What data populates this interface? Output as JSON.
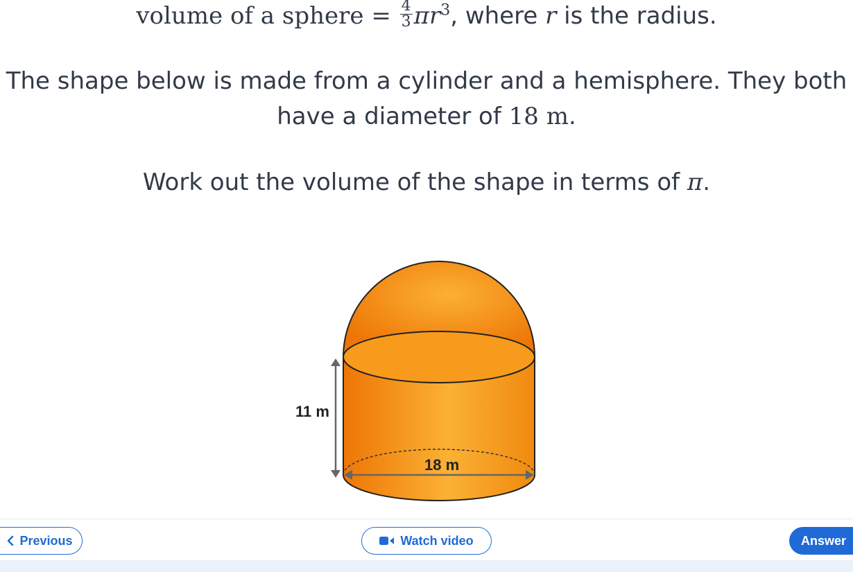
{
  "question": {
    "formula_prefix": "volume of a sphere",
    "formula_equals": "=",
    "frac_num": "4",
    "frac_den": "3",
    "formula_pi": "π",
    "formula_r": "r",
    "formula_exp": "3",
    "formula_suffix_a": ", where ",
    "formula_suffix_r": "r",
    "formula_suffix_b": " is the radius.",
    "line2": "The shape below is made from a cylinder and a hemisphere. They both",
    "line3_text": "have a diameter of ",
    "line3_value": "18 m",
    "line3_end": ".",
    "line4_text": "Work out the volume of the shape in terms of ",
    "line4_pi": "π",
    "line4_end": "."
  },
  "figure": {
    "height_label": "11 m",
    "diameter_label": "18 m",
    "colors": {
      "fill_dark": "#ee7606",
      "fill_light": "#fbb134",
      "stroke": "#222222"
    }
  },
  "footer": {
    "previous_label": "Previous",
    "watch_video_label": "Watch video",
    "answer_label": "Answer",
    "accent_color": "#1f6ad6"
  }
}
